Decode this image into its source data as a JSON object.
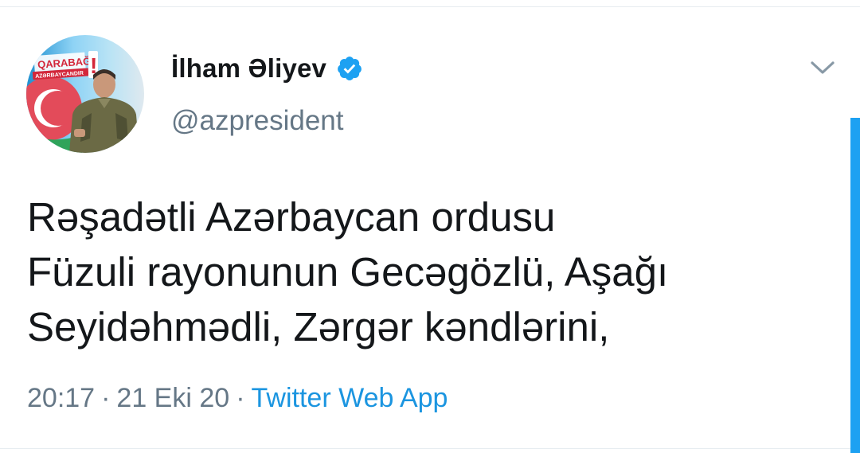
{
  "tweet": {
    "author": {
      "display_name": "İlham Əliyev",
      "handle": "@azpresident",
      "verified": true,
      "avatar": {
        "banner_text_1": "QARABAĞ",
        "banner_text_2": "AZƏRBAYCANDIR",
        "exclamation": "!"
      }
    },
    "text_lines": [
      "Rəşadətli Azərbaycan ordusu",
      "Füzuli rayonunun Gecəgözlü, Aşağı",
      "Seyidəhmədli, Zərgər kəndlərini,"
    ],
    "time": "20:17",
    "date": "21 Eki 20",
    "separator": "·",
    "source": "Twitter Web App"
  },
  "icons": {
    "verified": "verified-badge-icon",
    "menu": "chevron-down-icon"
  },
  "colors": {
    "text": "#14171a",
    "secondary": "#657786",
    "accent": "#1da1f2",
    "link": "#1b95e0",
    "divider": "#e6ecf0"
  }
}
